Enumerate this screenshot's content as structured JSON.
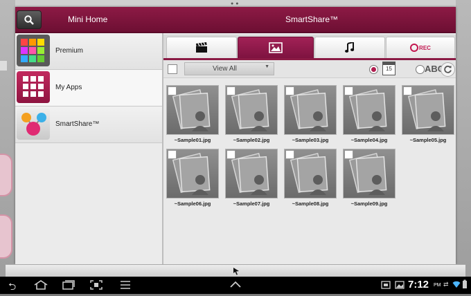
{
  "header": {
    "mini_home_label": "Mini Home",
    "title": "SmartShare™"
  },
  "sidebar": {
    "items": [
      {
        "label": "Premium"
      },
      {
        "label": "My Apps"
      },
      {
        "label": "SmartShare™"
      }
    ]
  },
  "tabs": [
    {
      "name": "video",
      "icon": "clapperboard-icon"
    },
    {
      "name": "photo",
      "icon": "image-icon",
      "active": true
    },
    {
      "name": "music",
      "icon": "music-note-icon"
    },
    {
      "name": "rec",
      "label": "REC"
    }
  ],
  "toolbar": {
    "filter_value": "View All",
    "calendar_day": "15",
    "sort_abc_label": "ABC"
  },
  "files": [
    "~Sample01.jpg",
    "~Sample02.jpg",
    "~Sample03.jpg",
    "~Sample04.jpg",
    "~Sample05.jpg",
    "~Sample06.jpg",
    "~Sample07.jpg",
    "~Sample08.jpg",
    "~Sample09.jpg"
  ],
  "status": {
    "time": "7:12",
    "ampm": "PM"
  },
  "colors": {
    "accent": "#8d1a45",
    "active_tab": "#a22156"
  }
}
